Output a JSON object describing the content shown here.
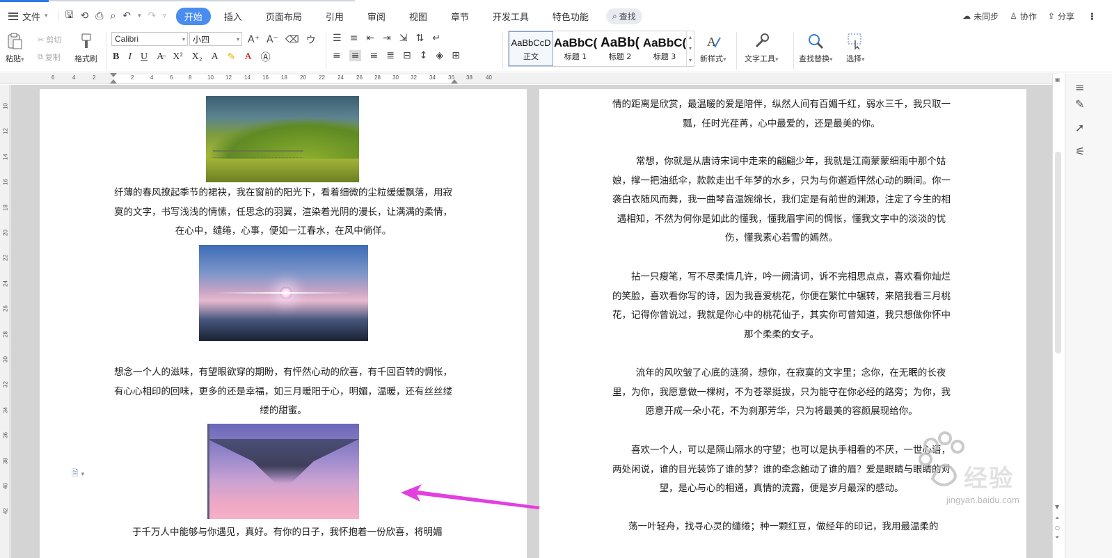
{
  "menubar": {
    "file_label": "文件",
    "tabs": [
      "开始",
      "插入",
      "页面布局",
      "引用",
      "审阅",
      "视图",
      "章节",
      "开发工具",
      "特色功能"
    ],
    "search_label": "查找",
    "sync_label": "未同步",
    "collab_label": "协作",
    "share_label": "分享"
  },
  "ribbon": {
    "paste_label": "粘贴",
    "cut_label": "剪切",
    "copy_label": "复制",
    "format_painter_label": "格式刷",
    "font_name": "Calibri",
    "font_size": "小四",
    "styles": [
      {
        "sample": "AaBbCcD",
        "label": "正文"
      },
      {
        "sample": "AaBbC(",
        "label": "标题 1"
      },
      {
        "sample": "AaBb(",
        "label": "标题 2"
      },
      {
        "sample": "AaBbC(",
        "label": "标题 3"
      }
    ],
    "new_style_label": "新样式",
    "text_tools_label": "文字工具",
    "find_replace_label": "查找替换",
    "select_label": "选择"
  },
  "ruler": {
    "ticks": [
      "6",
      "4",
      "2",
      "2",
      "4",
      "6",
      "8",
      "10",
      "12",
      "14",
      "16",
      "18",
      "20",
      "22",
      "24",
      "26",
      "28",
      "30",
      "32",
      "34",
      "36",
      "38",
      "40"
    ],
    "vticks": [
      "10",
      "12",
      "14",
      "16",
      "18",
      "20",
      "22",
      "24",
      "26",
      "28",
      "30",
      "32",
      "34",
      "36",
      "38",
      "40",
      "42"
    ]
  },
  "document": {
    "left_page": [
      "纤薄的春风撩起季节的裙袂，我在窗前的阳光下，看着细微的尘粒缓缓飘落，用寂寞的文字，书写浅浅的情愫，任思念的羽翼，渲染着光阴的漫长，让满满的柔情，在心中，缱绻，心事，便如一江春水，在风中倘佯。",
      "想念一个人的滋味，有望眼欲穿的期盼，有怦然心动的欣喜，有千回百转的惆怅，有心心相印的回味，更多的还是幸福，如三月暖阳于心，明媚，温暖，还有丝丝缕缕的甜蜜。",
      "于千万人中能够与你遇见，真好。有你的日子，我怀抱着一份欣喜，将明媚"
    ],
    "right_page": [
      "情的距离是欣赏，最温暖的爱是陪伴，纵然人间有百媚千红，弱水三千，我只取一瓢，任时光荏苒，心中最爱的，还是最美的你。",
      "常想，你就是从唐诗宋词中走来的翩翩少年，我就是江南蒙蒙细雨中那个姑娘，撑一把油纸伞，款款走出千年梦的水乡，只为与你邂逅怦然心动的瞬间。你一袭白衣随风而舞，我一曲琴音温婉绵长，我们定是有前世的渊源，注定了今生的相遇相知，不然为何你是如此的懂我，懂我眉宇间的惆怅，懂我文字中的淡淡的忧伤，懂我素心若雪的嫣然。",
      "拈一只瘦笔，写不尽柔情几许，吟一阙清词，诉不完相思点点，喜欢看你灿烂的笑脸，喜欢看你写的诗，因为我喜爱桃花，你便在繁忙中辗转，来陪我看三月桃花，记得你曾说过，我就是你心中的桃花仙子，其实你可曾知道，我只想做你怀中那个柔柔的女子。",
      "流年的风吹皱了心底的涟漪，想你，在寂寞的文字里；念你，在无眠的长夜里，为你，我愿意做一棵树，不为苍翠挺拔，只为能守在你必经的路旁；为你，我愿意开成一朵小花，不为刹那芳华，只为将最美的容颜展现给你。",
      "喜欢一个人，可以是隔山隔水的守望；也可以是执手相看的不厌，一世心语，两处闲说，谁的目光装饰了谁的梦？谁的牵念触动了谁的眉？爱是眼睛与眼睛的对望，是心与心的相通，真情的流露，便是岁月最深的感动。",
      "荡一叶轻舟，找寻心灵的缱绻；种一颗红豆，做经年的印记，我用最温柔的"
    ]
  },
  "watermark": {
    "text": "经验",
    "url": "jingyan.baidu.com"
  },
  "colors": {
    "active_tab": "#4a8df0",
    "arrow": "#e23ee0"
  }
}
